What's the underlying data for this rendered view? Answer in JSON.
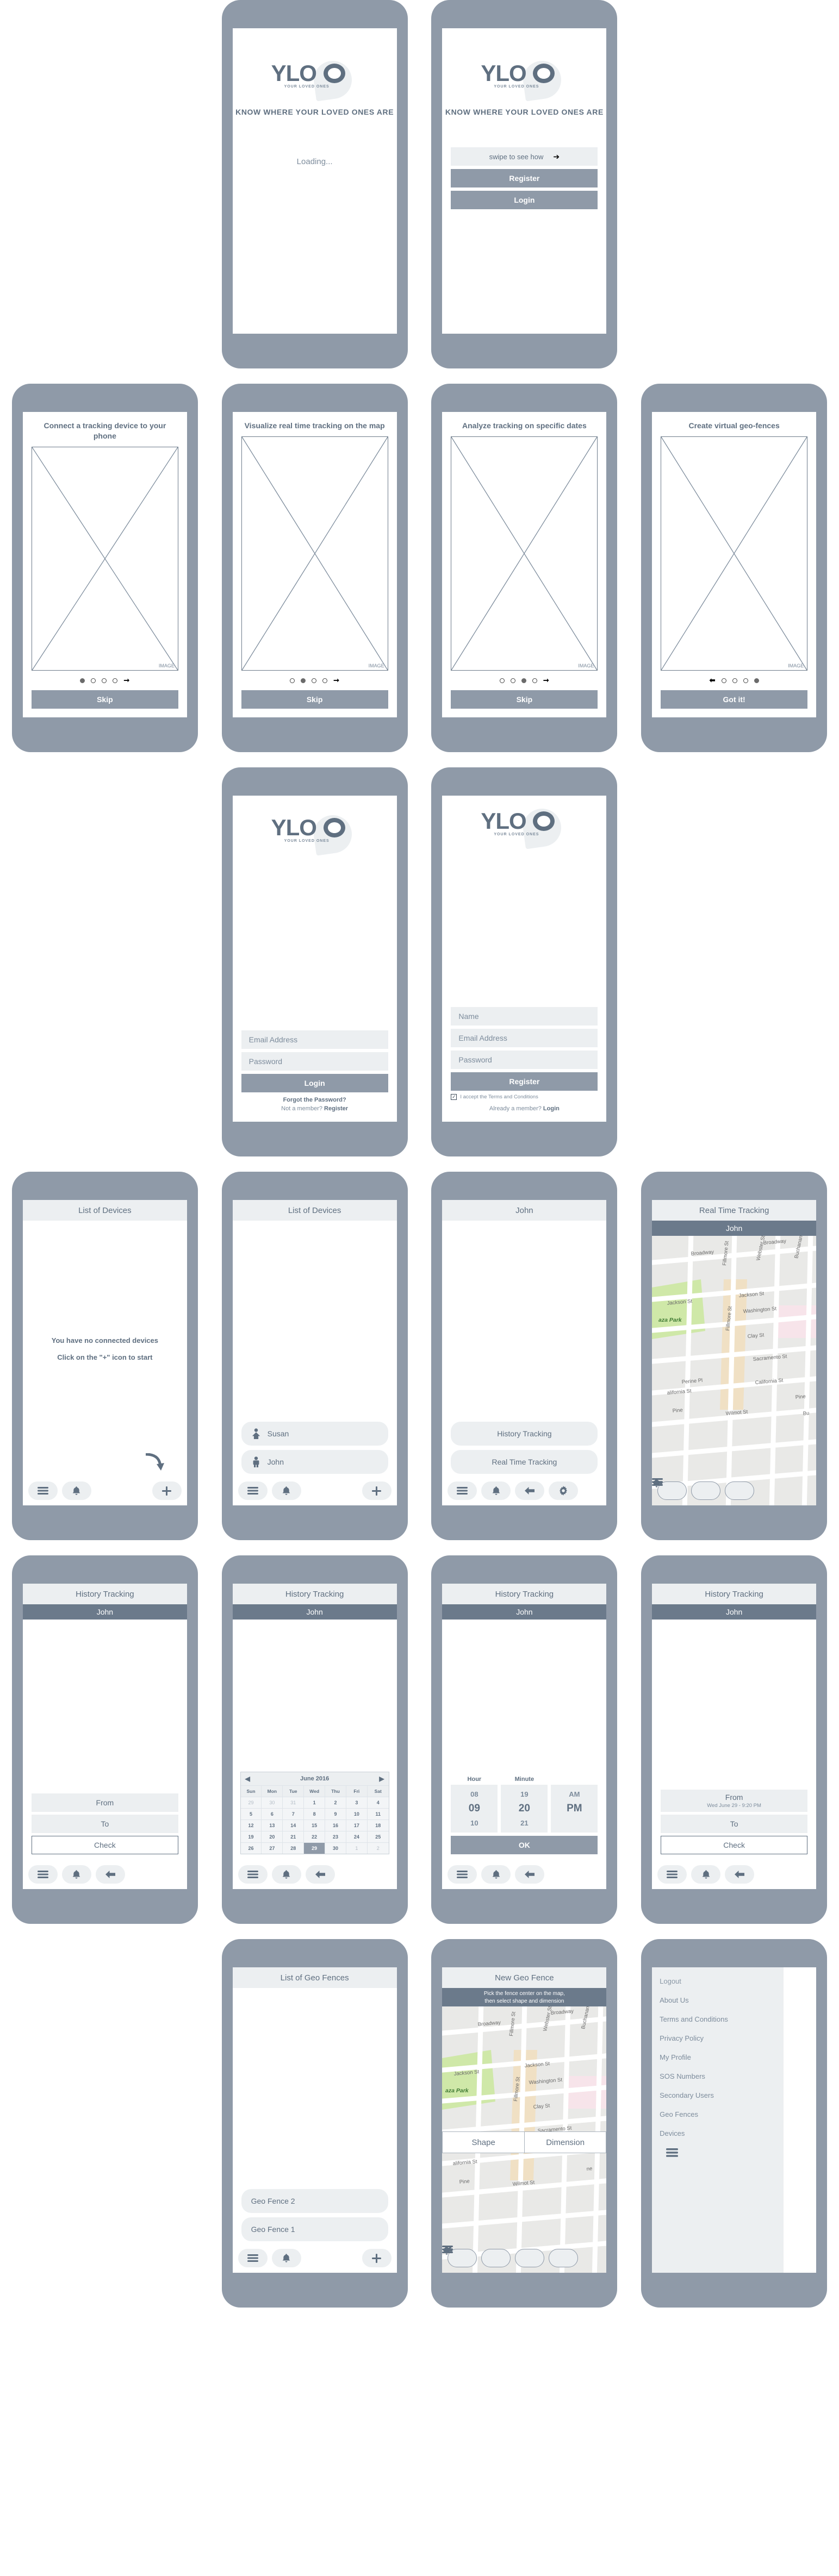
{
  "brand": {
    "name": "YLO",
    "subtitle": "YOUR LOVED ONES",
    "tagline": "KNOW WHERE YOUR LOVED ONES ARE"
  },
  "splash": {
    "loading": "Loading..."
  },
  "welcome": {
    "swipe": "swipe to see how",
    "swipe_arrow": "➔",
    "register": "Register",
    "login": "Login"
  },
  "onboarding": {
    "image_label": "IMAGE",
    "slides": [
      {
        "title": "Connect a tracking device to your phone",
        "button": "Skip",
        "active": 0,
        "arrow": "forward"
      },
      {
        "title": "Visualize real time tracking on the map",
        "button": "Skip",
        "active": 1,
        "arrow": "forward"
      },
      {
        "title": "Analyze tracking on specific dates",
        "button": "Skip",
        "active": 2,
        "arrow": "forward"
      },
      {
        "title": "Create virtual geo-fences",
        "button": "Got it!",
        "active": 3,
        "arrow": "back"
      }
    ]
  },
  "login": {
    "email_placeholder": "Email Address",
    "password_placeholder": "Password",
    "submit": "Login",
    "forgot": "Forgot the Password?",
    "member_prompt": "Not a member? ",
    "member_link": "Register"
  },
  "register": {
    "name_placeholder": "Name",
    "email_placeholder": "Email Address",
    "password_placeholder": "Password",
    "submit": "Register",
    "terms": "I accept the Terms and Conditions",
    "terms_checked": true,
    "member_prompt": "Already a member? ",
    "member_link": "Login"
  },
  "devices_empty": {
    "title": "List of Devices",
    "message_line1": "You have no connected devices",
    "message_line2": "Click on the \"+\" icon to start"
  },
  "devices_list": {
    "title": "List of Devices",
    "items": [
      {
        "name": "Susan",
        "icon": "woman-icon"
      },
      {
        "name": "John",
        "icon": "man-icon"
      }
    ]
  },
  "device_detail": {
    "title": "John",
    "options": [
      "History Tracking",
      "Real Time Tracking"
    ]
  },
  "real_time": {
    "title": "Real Time Tracking",
    "subject": "John"
  },
  "history_empty": {
    "title": "History Tracking",
    "subject": "John",
    "from_label": "From",
    "to_label": "To",
    "check_label": "Check"
  },
  "history_calendar": {
    "title": "History Tracking",
    "subject": "John",
    "month": "June 2016",
    "prev": "◀",
    "next": "▶",
    "dow": [
      "Sun",
      "Mon",
      "Tue",
      "Wed",
      "Thu",
      "Fri",
      "Sat"
    ],
    "weeks": [
      [
        {
          "d": "29",
          "m": true
        },
        {
          "d": "30",
          "m": true
        },
        {
          "d": "31",
          "m": true
        },
        {
          "d": "1"
        },
        {
          "d": "2"
        },
        {
          "d": "3"
        },
        {
          "d": "4"
        }
      ],
      [
        {
          "d": "5"
        },
        {
          "d": "6"
        },
        {
          "d": "7"
        },
        {
          "d": "8"
        },
        {
          "d": "9"
        },
        {
          "d": "10"
        },
        {
          "d": "11"
        }
      ],
      [
        {
          "d": "12"
        },
        {
          "d": "13"
        },
        {
          "d": "14"
        },
        {
          "d": "15"
        },
        {
          "d": "16"
        },
        {
          "d": "17"
        },
        {
          "d": "18"
        }
      ],
      [
        {
          "d": "19"
        },
        {
          "d": "20"
        },
        {
          "d": "21"
        },
        {
          "d": "22"
        },
        {
          "d": "23"
        },
        {
          "d": "24"
        },
        {
          "d": "25"
        }
      ],
      [
        {
          "d": "26"
        },
        {
          "d": "27"
        },
        {
          "d": "28"
        },
        {
          "d": "29",
          "sel": true
        },
        {
          "d": "30"
        },
        {
          "d": "1",
          "m": true
        },
        {
          "d": "2",
          "m": true
        }
      ]
    ]
  },
  "history_time": {
    "title": "History Tracking",
    "subject": "John",
    "hour_label": "Hour",
    "minute_label": "Minute",
    "hours": [
      "08",
      "09",
      "10"
    ],
    "hour_selected": "09",
    "minutes": [
      "19",
      "20",
      "21"
    ],
    "minute_selected": "20",
    "meridiem": [
      "AM",
      "PM"
    ],
    "meridiem_selected": "PM",
    "ok": "OK"
  },
  "history_filled": {
    "title": "History Tracking",
    "subject": "John",
    "from_label": "From",
    "from_value": "Wed June 29 - 9:20 PM",
    "to_label": "To",
    "check_label": "Check"
  },
  "geofence_list": {
    "title": "List of Geo Fences",
    "items": [
      "Geo Fence 2",
      "Geo Fence 1"
    ]
  },
  "geofence_new": {
    "title": "New Geo Fence",
    "instruction_line1": "Pick the fence center on the map,",
    "instruction_line2": "then select shape and dimension",
    "shape": "Shape",
    "dimension": "Dimension"
  },
  "drawer": {
    "items": [
      "Logout",
      "About Us",
      "Terms and Conditions",
      "Privacy Policy",
      "My Profile",
      "SOS Numbers",
      "Secondary Users",
      "Geo Fences",
      "Devices"
    ]
  },
  "map_labels": {
    "streets": [
      "Broadway",
      "Fillmore St",
      "Webster St",
      "Buchanan St",
      "Jackson St",
      "Washington St",
      "Clay St",
      "Sacramento St",
      "California St",
      "Perine Pl",
      "Pine St",
      "Wilmot St"
    ],
    "park": "aza Park"
  },
  "colors": {
    "frame": "#8f9aa8",
    "screen": "#ffffff",
    "field": "#eceff1",
    "text": "#5f6f80",
    "subbar": "#6b7a8b",
    "accent": "#8f9aa8"
  }
}
